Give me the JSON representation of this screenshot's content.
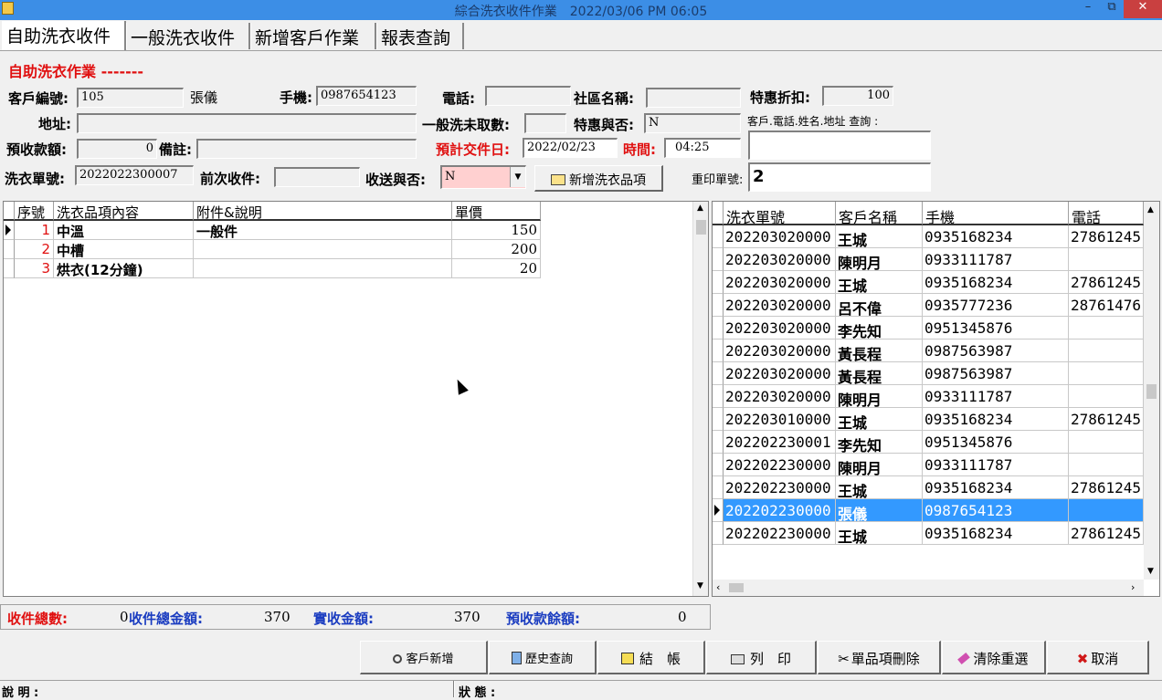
{
  "window": {
    "title": "綜合洗衣收件作業　2022/03/06 PM 06:05",
    "minimize": "–",
    "restore": "⧉",
    "close": "✕"
  },
  "tabs": [
    {
      "label": "自助洗衣收件"
    },
    {
      "label": "一般洗衣收件"
    },
    {
      "label": "新增客戶作業"
    },
    {
      "label": "報表查詢"
    }
  ],
  "form": {
    "section_title": "自助洗衣作業 -------",
    "customer_no_label": "客戶編號:",
    "customer_no": "105",
    "customer_name": "張儀",
    "mobile_label": "手機:",
    "mobile": "0987654123",
    "phone_label": "電話:",
    "phone": "",
    "community_label": "社區名稱:",
    "community": "",
    "discount_label": "特惠折扣:",
    "discount": "100",
    "address_label": "地址:",
    "address": "",
    "uncollected_label": "一般洗未取數:",
    "uncollected": "",
    "special_label": "特惠與否:",
    "special": "N",
    "query_hint": "客戶.電話.姓名.地址 查詢 :",
    "query": "",
    "prepay_label": "預收款額:",
    "prepay": "0",
    "note_label": "備註:",
    "note": "",
    "due_date_label": "預計交件日:",
    "due_date": "2022/02/23",
    "time_label": "時間:",
    "time": "04:25",
    "order_no_label": "洗衣單號:",
    "order_no": "2022022300007",
    "prev_label": "前次收件:",
    "prev": "",
    "delivery_label": "收送與否:",
    "delivery": "N",
    "add_item_button": "新增洗衣品項",
    "reprint_label": "重印單號:",
    "reprint": "2"
  },
  "items_table": {
    "headers": [
      "序號",
      "洗衣品項內容",
      "附件&說明",
      "單價"
    ],
    "rows": [
      {
        "no": "1",
        "item": "中溫",
        "note": "一般件",
        "price": "150"
      },
      {
        "no": "2",
        "item": "中槽",
        "note": "",
        "price": "200"
      },
      {
        "no": "3",
        "item": "烘衣(12分鐘)",
        "note": "",
        "price": "20"
      }
    ]
  },
  "orders_table": {
    "headers": [
      "洗衣單號",
      "客戶名稱",
      "手機",
      "電話"
    ],
    "rows": [
      {
        "order": "202203020000",
        "name": "王城",
        "mobile": "0935168234",
        "phone": "27861245"
      },
      {
        "order": "202203020000",
        "name": "陳明月",
        "mobile": "0933111787",
        "phone": ""
      },
      {
        "order": "202203020000",
        "name": "王城",
        "mobile": "0935168234",
        "phone": "27861245"
      },
      {
        "order": "202203020000",
        "name": "呂不偉",
        "mobile": "0935777236",
        "phone": "28761476"
      },
      {
        "order": "202203020000",
        "name": "李先知",
        "mobile": "0951345876",
        "phone": ""
      },
      {
        "order": "202203020000",
        "name": "黃長程",
        "mobile": "0987563987",
        "phone": ""
      },
      {
        "order": "202203020000",
        "name": "黃長程",
        "mobile": "0987563987",
        "phone": ""
      },
      {
        "order": "202203020000",
        "name": "陳明月",
        "mobile": "0933111787",
        "phone": ""
      },
      {
        "order": "202203010000",
        "name": "王城",
        "mobile": "0935168234",
        "phone": "27861245"
      },
      {
        "order": "202202230001",
        "name": "李先知",
        "mobile": "0951345876",
        "phone": ""
      },
      {
        "order": "202202230000",
        "name": "陳明月",
        "mobile": "0933111787",
        "phone": ""
      },
      {
        "order": "202202230000",
        "name": "王城",
        "mobile": "0935168234",
        "phone": "27861245"
      },
      {
        "order": "202202230000",
        "name": "張儀",
        "mobile": "0987654123",
        "phone": ""
      },
      {
        "order": "202202230000",
        "name": "王城",
        "mobile": "0935168234",
        "phone": "27861245"
      }
    ],
    "selected_row": 12
  },
  "summary": {
    "count_label": "收件總數:",
    "count": "0",
    "total_label": "收件總金額:",
    "total": "370",
    "received_label": "實收金額:",
    "received": "370",
    "balance_label": "預收款餘額:",
    "balance": "0"
  },
  "buttons": {
    "add_customer": "客戶新增",
    "history": "歷史查詢",
    "checkout": "結　帳",
    "print": "列　印",
    "delete_item": "單品項刪除",
    "clear": "清除重選",
    "cancel": "取消"
  },
  "status": {
    "desc_label": "說 明 :",
    "state_label": "狀 態 :"
  },
  "colors": {
    "title_bar": "#3c8ee6",
    "selected_row": "#3399ff",
    "red_label": "#e01010",
    "blue_label": "#1a3cc0",
    "delivery_field": "#ffd0d0"
  }
}
